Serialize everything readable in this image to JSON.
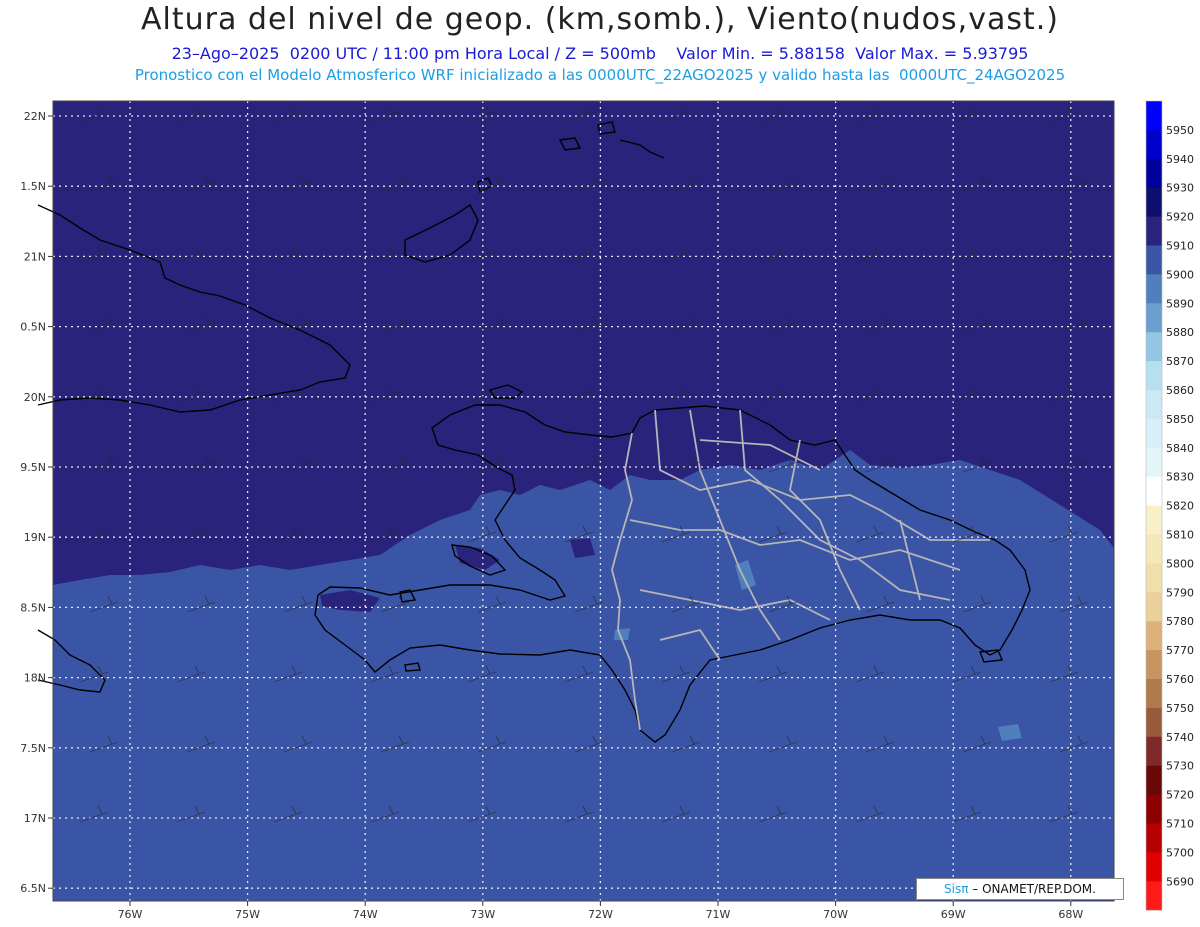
{
  "header": {
    "title": "Altura del nivel de geop. (km,somb.), Viento(nudos,vast.)",
    "date": "23–Ago–2025",
    "time_utc": "0200 UTC",
    "time_local": "11:00 pm Hora Local",
    "level": "Z = 500mb",
    "value_min_label": "Valor Min. = 5.88158",
    "value_max_label": "Valor Max. = 5.93795",
    "subtitle2": "Pronostico con el Modelo Atmosferico WRF inicializado a las 0000UTC_22AGO2025 y valido hasta las  0000UTC_24AGO2025"
  },
  "axes": {
    "lat_labels": [
      "22N",
      "1.5N",
      "21N",
      "0.5N",
      "20N",
      "9.5N",
      "19N",
      "8.5N",
      "18N",
      "7.5N",
      "17N",
      "6.5N"
    ],
    "lon_labels": [
      "76W",
      "75W",
      "74W",
      "73W",
      "72W",
      "71W",
      "70W",
      "69W",
      "68W"
    ]
  },
  "colorbar": {
    "levels": [
      "5950",
      "5940",
      "5930",
      "5920",
      "5910",
      "5900",
      "5890",
      "5880",
      "5870",
      "5860",
      "5850",
      "5840",
      "5830",
      "5820",
      "5810",
      "5800",
      "5790",
      "5780",
      "5770",
      "5760",
      "5750",
      "5740",
      "5730",
      "5720",
      "5710",
      "5700",
      "5690"
    ],
    "colors": [
      "#0000ff",
      "#0000cc",
      "#00009a",
      "#0e0e6e",
      "#29237c",
      "#3b55a6",
      "#4f80bd",
      "#6a9fd0",
      "#93c6e2",
      "#b6dff0",
      "#cae9f4",
      "#d8eff8",
      "#e4f5fa",
      "#ffffff",
      "#f8f0c8",
      "#f5e8b8",
      "#f1dfaa",
      "#ead09a",
      "#dcb27a",
      "#c89560",
      "#b07a4c",
      "#9a5a3c",
      "#7e2a2a",
      "#6a0808",
      "#8c0000",
      "#b40000",
      "#e00000",
      "#ff1a1a"
    ]
  },
  "map_colors": {
    "high": "#29237c",
    "mid": "#3b55a6",
    "low": "#4f80bd",
    "deep": "#14145e"
  },
  "credit": {
    "sis": "Sisπ",
    "org": "–  ONAMET/REP.DOM."
  }
}
